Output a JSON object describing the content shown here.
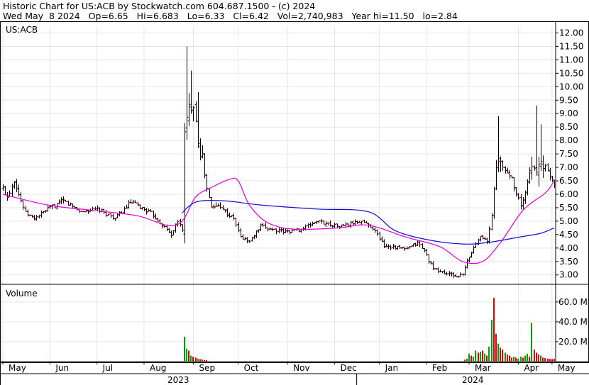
{
  "header": {
    "line1": "Historic Chart for US:ACB by Stockwatch.com 604.687.1500 - (c) 2024",
    "line2": "Wed May  8 2024   Op=6.65   Hi=6.683   Lo=6.33   Cl=6.42   Vol=2,740,983   Year hi=11.50   lo=2.84"
  },
  "chart_data": [
    {
      "type": "ohlc",
      "label": "US:ACB",
      "y_ticks": [
        "12.00",
        "11.50",
        "11.00",
        "10.50",
        "10.00",
        "9.50",
        "9.00",
        "8.50",
        "8.00",
        "7.50",
        "7.00",
        "6.50",
        "6.00",
        "5.50",
        "5.00",
        "4.50",
        "4.00",
        "3.50",
        "3.00"
      ],
      "ylim": [
        2.65,
        12.25
      ],
      "months": [
        "May",
        "Jun",
        "Jul",
        "Aug",
        "Sep",
        "Oct",
        "Nov",
        "Dec",
        "Jan",
        "Feb",
        "Mar",
        "Apr",
        "May"
      ],
      "years": [
        "2023",
        "2024"
      ],
      "grid": true,
      "close_anchors": [
        {
          "t": 0,
          "v": 6.2
        },
        {
          "t": 2,
          "v": 5.9
        },
        {
          "t": 5,
          "v": 6.55
        },
        {
          "t": 7,
          "v": 6.0
        },
        {
          "t": 10,
          "v": 5.3
        },
        {
          "t": 14,
          "v": 5.1
        },
        {
          "t": 20,
          "v": 5.45
        },
        {
          "t": 27,
          "v": 5.75
        },
        {
          "t": 35,
          "v": 5.35
        },
        {
          "t": 42,
          "v": 5.45
        },
        {
          "t": 50,
          "v": 5.1
        },
        {
          "t": 57,
          "v": 5.7
        },
        {
          "t": 66,
          "v": 5.3
        },
        {
          "t": 75,
          "v": 4.5
        },
        {
          "t": 78,
          "v": 5.0
        },
        {
          "t": 80,
          "v": 4.7
        },
        {
          "t": 81,
          "v": 8.2
        },
        {
          "t": 83,
          "v": 9.2
        },
        {
          "t": 85,
          "v": 9.5
        },
        {
          "t": 87,
          "v": 8.0
        },
        {
          "t": 89,
          "v": 7.3
        },
        {
          "t": 91,
          "v": 6.2
        },
        {
          "t": 93,
          "v": 5.5
        },
        {
          "t": 97,
          "v": 5.6
        },
        {
          "t": 100,
          "v": 5.25
        },
        {
          "t": 103,
          "v": 5.1
        },
        {
          "t": 106,
          "v": 4.4
        },
        {
          "t": 110,
          "v": 4.25
        },
        {
          "t": 115,
          "v": 4.8
        },
        {
          "t": 125,
          "v": 4.6
        },
        {
          "t": 133,
          "v": 4.7
        },
        {
          "t": 140,
          "v": 5.0
        },
        {
          "t": 150,
          "v": 4.8
        },
        {
          "t": 160,
          "v": 5.0
        },
        {
          "t": 165,
          "v": 4.75
        },
        {
          "t": 170,
          "v": 4.1
        },
        {
          "t": 180,
          "v": 3.95
        },
        {
          "t": 185,
          "v": 4.2
        },
        {
          "t": 188,
          "v": 3.9
        },
        {
          "t": 192,
          "v": 3.2
        },
        {
          "t": 198,
          "v": 3.05
        },
        {
          "t": 202,
          "v": 2.95
        },
        {
          "t": 205,
          "v": 3.0
        },
        {
          "t": 207,
          "v": 3.5
        },
        {
          "t": 210,
          "v": 4.0
        },
        {
          "t": 213,
          "v": 4.5
        },
        {
          "t": 216,
          "v": 4.2
        },
        {
          "t": 218,
          "v": 5.2
        },
        {
          "t": 220,
          "v": 7.2
        },
        {
          "t": 223,
          "v": 7.0
        },
        {
          "t": 227,
          "v": 6.6
        },
        {
          "t": 229,
          "v": 6.0
        },
        {
          "t": 231,
          "v": 5.6
        },
        {
          "t": 233,
          "v": 6.0
        },
        {
          "t": 236,
          "v": 7.2
        },
        {
          "t": 238,
          "v": 6.8
        },
        {
          "t": 240,
          "v": 7.3
        },
        {
          "t": 242,
          "v": 7.0
        },
        {
          "t": 244,
          "v": 6.7
        },
        {
          "t": 246,
          "v": 6.42
        }
      ],
      "spikes": [
        {
          "t": 82,
          "v": 11.5
        },
        {
          "t": 84,
          "v": 10.6
        },
        {
          "t": 87,
          "v": 9.8
        },
        {
          "t": 221,
          "v": 8.9
        },
        {
          "t": 238,
          "v": 9.3
        },
        {
          "t": 240,
          "v": 8.6
        }
      ],
      "series": [
        {
          "name": "MA20",
          "color": "#e000e0",
          "points": [
            {
              "t": 0,
              "v": 6.0
            },
            {
              "t": 20,
              "v": 5.6
            },
            {
              "t": 40,
              "v": 5.4
            },
            {
              "t": 60,
              "v": 5.2
            },
            {
              "t": 73,
              "v": 4.85
            },
            {
              "t": 80,
              "v": 5.0
            },
            {
              "t": 86,
              "v": 5.9
            },
            {
              "t": 93,
              "v": 6.25
            },
            {
              "t": 101,
              "v": 6.55
            },
            {
              "t": 105,
              "v": 6.5
            },
            {
              "t": 110,
              "v": 5.6
            },
            {
              "t": 118,
              "v": 4.95
            },
            {
              "t": 130,
              "v": 4.7
            },
            {
              "t": 150,
              "v": 4.75
            },
            {
              "t": 163,
              "v": 4.85
            },
            {
              "t": 180,
              "v": 4.4
            },
            {
              "t": 195,
              "v": 4.05
            },
            {
              "t": 205,
              "v": 3.5
            },
            {
              "t": 214,
              "v": 3.5
            },
            {
              "t": 222,
              "v": 4.2
            },
            {
              "t": 232,
              "v": 5.4
            },
            {
              "t": 242,
              "v": 6.05
            },
            {
              "t": 246,
              "v": 6.5
            }
          ]
        },
        {
          "name": "MA100",
          "color": "#1010d0",
          "points": [
            {
              "t": 80,
              "v": 5.3
            },
            {
              "t": 83,
              "v": 5.55
            },
            {
              "t": 88,
              "v": 5.75
            },
            {
              "t": 100,
              "v": 5.75
            },
            {
              "t": 115,
              "v": 5.6
            },
            {
              "t": 140,
              "v": 5.45
            },
            {
              "t": 163,
              "v": 5.35
            },
            {
              "t": 175,
              "v": 4.65
            },
            {
              "t": 190,
              "v": 4.3
            },
            {
              "t": 205,
              "v": 4.15
            },
            {
              "t": 216,
              "v": 4.2
            },
            {
              "t": 230,
              "v": 4.4
            },
            {
              "t": 240,
              "v": 4.55
            },
            {
              "t": 246,
              "v": 4.75
            }
          ]
        }
      ]
    },
    {
      "type": "bar",
      "label": "Volume",
      "y_ticks": [
        "60.0 M",
        "40.0 M",
        "20.0 M"
      ],
      "ylim": [
        0,
        72
      ],
      "unit": "M",
      "colors": {
        "up": "#00a000",
        "down": "#e00000"
      },
      "bars": [
        {
          "t": 81,
          "v": 25.0,
          "c": "up"
        },
        {
          "t": 82,
          "v": 13.0,
          "c": "up"
        },
        {
          "t": 83,
          "v": 11.0,
          "c": "down"
        },
        {
          "t": 84,
          "v": 6.0,
          "c": "up"
        },
        {
          "t": 85,
          "v": 5.0,
          "c": "down"
        },
        {
          "t": 86,
          "v": 4.0,
          "c": "down"
        },
        {
          "t": 87,
          "v": 3.0,
          "c": "up"
        },
        {
          "t": 88,
          "v": 2.5,
          "c": "down"
        },
        {
          "t": 89,
          "v": 2.0,
          "c": "down"
        },
        {
          "t": 90,
          "v": 1.5,
          "c": "down"
        },
        {
          "t": 91,
          "v": 1.5,
          "c": "down"
        },
        {
          "t": 206,
          "v": 1.8,
          "c": "down"
        },
        {
          "t": 207,
          "v": 3.0,
          "c": "up"
        },
        {
          "t": 208,
          "v": 8.0,
          "c": "up"
        },
        {
          "t": 209,
          "v": 6.0,
          "c": "down"
        },
        {
          "t": 210,
          "v": 5.0,
          "c": "up"
        },
        {
          "t": 211,
          "v": 11.0,
          "c": "up"
        },
        {
          "t": 212,
          "v": 9.0,
          "c": "down"
        },
        {
          "t": 213,
          "v": 10.0,
          "c": "up"
        },
        {
          "t": 214,
          "v": 11.0,
          "c": "down"
        },
        {
          "t": 215,
          "v": 8.0,
          "c": "up"
        },
        {
          "t": 216,
          "v": 6.0,
          "c": "down"
        },
        {
          "t": 217,
          "v": 15.0,
          "c": "up"
        },
        {
          "t": 218,
          "v": 42.0,
          "c": "up"
        },
        {
          "t": 219,
          "v": 64.0,
          "c": "down"
        },
        {
          "t": 220,
          "v": 28.0,
          "c": "down"
        },
        {
          "t": 221,
          "v": 18.0,
          "c": "up"
        },
        {
          "t": 222,
          "v": 14.0,
          "c": "down"
        },
        {
          "t": 223,
          "v": 12.0,
          "c": "down"
        },
        {
          "t": 224,
          "v": 9.0,
          "c": "up"
        },
        {
          "t": 225,
          "v": 7.0,
          "c": "down"
        },
        {
          "t": 226,
          "v": 6.0,
          "c": "down"
        },
        {
          "t": 227,
          "v": 4.0,
          "c": "down"
        },
        {
          "t": 228,
          "v": 5.0,
          "c": "up"
        },
        {
          "t": 229,
          "v": 4.0,
          "c": "down"
        },
        {
          "t": 230,
          "v": 3.0,
          "c": "up"
        },
        {
          "t": 231,
          "v": 5.0,
          "c": "up"
        },
        {
          "t": 232,
          "v": 4.0,
          "c": "down"
        },
        {
          "t": 233,
          "v": 6.0,
          "c": "up"
        },
        {
          "t": 234,
          "v": 8.0,
          "c": "up"
        },
        {
          "t": 235,
          "v": 5.0,
          "c": "down"
        },
        {
          "t": 236,
          "v": 39.0,
          "c": "up"
        },
        {
          "t": 237,
          "v": 12.0,
          "c": "down"
        },
        {
          "t": 238,
          "v": 9.0,
          "c": "down"
        },
        {
          "t": 239,
          "v": 7.0,
          "c": "down"
        },
        {
          "t": 240,
          "v": 6.0,
          "c": "up"
        },
        {
          "t": 241,
          "v": 4.0,
          "c": "down"
        },
        {
          "t": 242,
          "v": 3.5,
          "c": "down"
        },
        {
          "t": 243,
          "v": 3.0,
          "c": "down"
        },
        {
          "t": 244,
          "v": 2.7,
          "c": "down"
        },
        {
          "t": 245,
          "v": 2.5,
          "c": "down"
        },
        {
          "t": 246,
          "v": 2.74,
          "c": "down"
        }
      ]
    }
  ]
}
